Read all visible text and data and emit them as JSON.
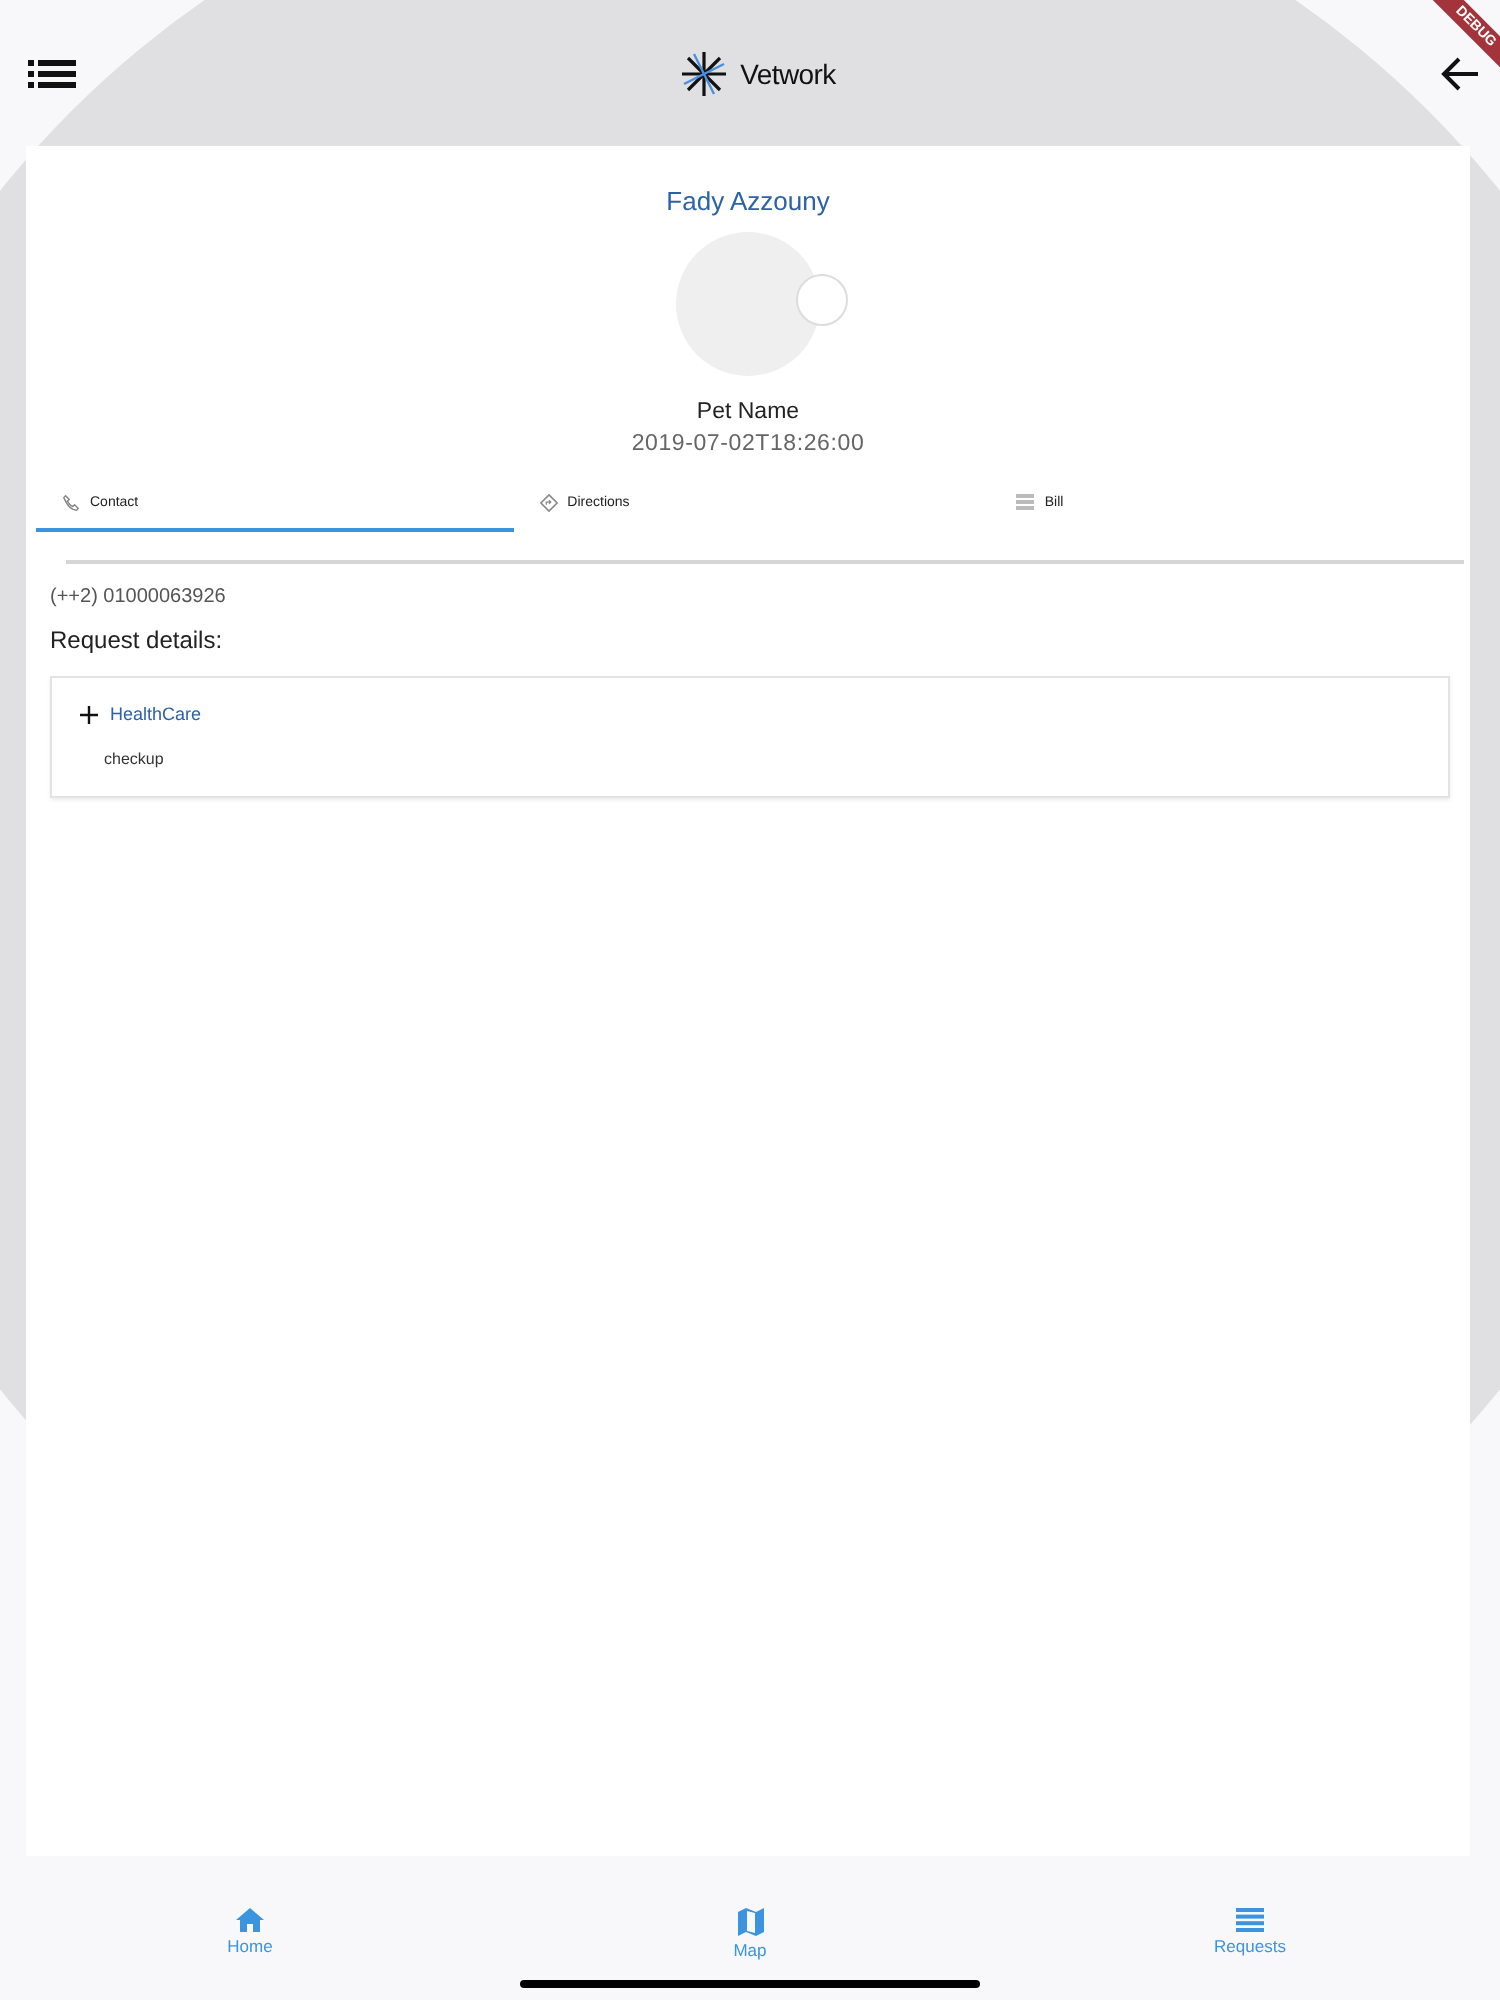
{
  "app_bar": {
    "title": "Vetwork",
    "debug_banner": "DEBUG"
  },
  "profile": {
    "owner_name": "Fady Azzouny",
    "pet_name": "Pet Name",
    "date": "2019-07-02T18:26:00"
  },
  "tabs": [
    {
      "label": "Contact",
      "kind": "phone",
      "selected": true
    },
    {
      "label": "Directions",
      "kind": "directions",
      "selected": false
    },
    {
      "label": "Bill",
      "kind": "list",
      "selected": false
    }
  ],
  "contact": {
    "phone": "(++2) 01000063926"
  },
  "request_details": {
    "heading": "Request details:",
    "service": "HealthCare",
    "items": [
      "checkup"
    ]
  },
  "bottom_nav": [
    {
      "label": "Home",
      "kind": "home"
    },
    {
      "label": "Map",
      "kind": "map"
    },
    {
      "label": "Requests",
      "kind": "list"
    }
  ]
}
